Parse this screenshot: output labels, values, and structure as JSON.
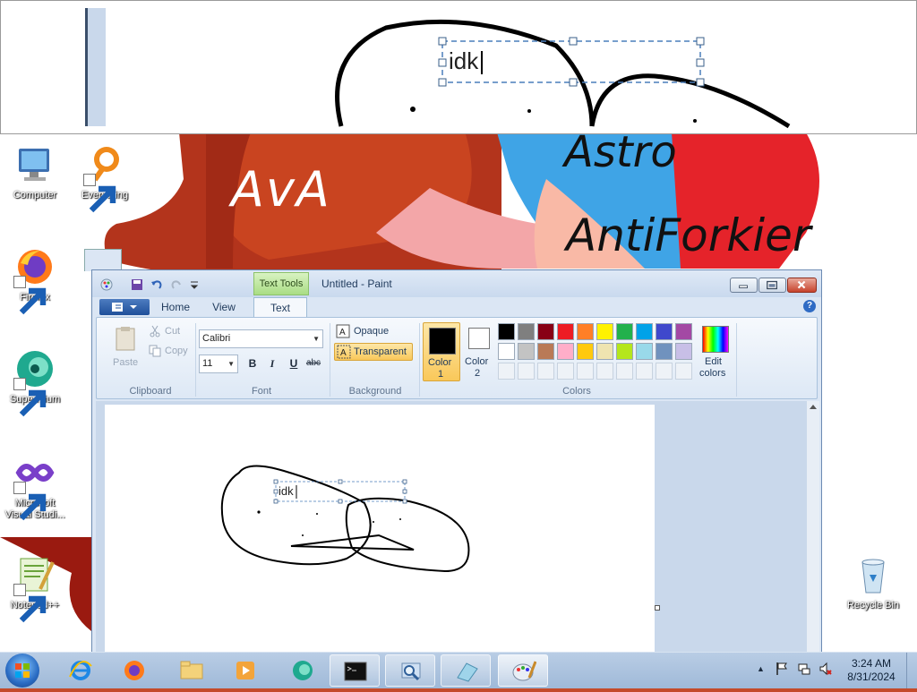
{
  "wallpaper": {
    "texts": [
      "AvA",
      "Astro",
      "AntiForkier"
    ]
  },
  "magnifier": {
    "text": "idk"
  },
  "desktop_icons": [
    {
      "label": "Computer"
    },
    {
      "label": "Everything"
    },
    {
      "label": "Firefox"
    },
    {
      "label": "Supermium"
    },
    {
      "label": "Microsoft Visual Studi..."
    },
    {
      "label": "Notepad++"
    },
    {
      "label": "Recycle Bin"
    }
  ],
  "paint": {
    "contextual_tab": "Text Tools",
    "title": "Untitled - Paint",
    "tabs": [
      "Home",
      "View",
      "Text"
    ],
    "clipboard": {
      "paste": "Paste",
      "cut": "Cut",
      "copy": "Copy",
      "group": "Clipboard"
    },
    "font": {
      "family": "Calibri",
      "size": "11",
      "bold": "B",
      "italic": "I",
      "underline": "U",
      "strike": "abc",
      "group": "Font"
    },
    "background": {
      "opaque": "Opaque",
      "transparent": "Transparent",
      "group": "Background"
    },
    "colors": {
      "color1_label": "Color",
      "color1_num": "1",
      "color2_label": "Color",
      "color2_num": "2",
      "color1_value": "#000000",
      "color2_value": "#ffffff",
      "edit_label": "Edit",
      "edit_label2": "colors",
      "group": "Colors",
      "palette_row1": [
        "#000000",
        "#7f7f7f",
        "#880015",
        "#ed1c24",
        "#ff7f27",
        "#fff200",
        "#22b14c",
        "#00a2e8",
        "#3f48cc",
        "#a349a4"
      ],
      "palette_row2": [
        "#ffffff",
        "#c3c3c3",
        "#b97a57",
        "#ffaec9",
        "#ffc90e",
        "#efe4b0",
        "#b5e61d",
        "#99d9ea",
        "#7092be",
        "#c8bfe7"
      ]
    },
    "canvas_text": "idk"
  },
  "taskbar": {
    "clock_time": "3:24 AM",
    "clock_date": "8/31/2024"
  }
}
